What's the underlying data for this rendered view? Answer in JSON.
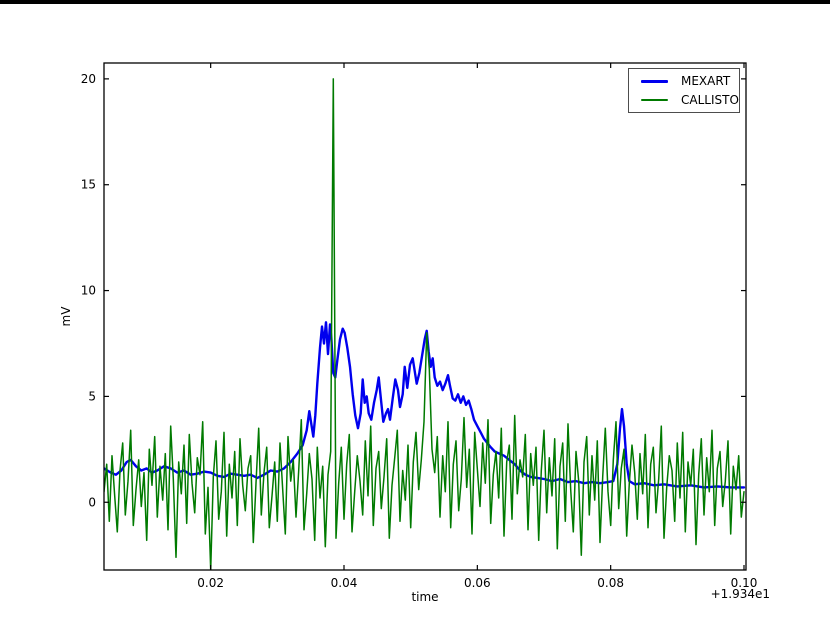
{
  "window": {
    "top_strip_color": "#000000",
    "background_color": "#ffffff"
  },
  "chart_data": {
    "type": "line",
    "title": "",
    "xlabel": "time",
    "ylabel": "mV",
    "x_offset_label": "+1.934e1",
    "grid": false,
    "axis_color": "#000000",
    "xlim": [
      0.004,
      0.1003
    ],
    "ylim": [
      -3.2,
      20.75
    ],
    "xticks": [
      {
        "v": 0.02,
        "label": "0.02"
      },
      {
        "v": 0.04,
        "label": "0.04"
      },
      {
        "v": 0.06,
        "label": "0.06"
      },
      {
        "v": 0.08,
        "label": "0.08"
      },
      {
        "v": 0.1,
        "label": "0.10"
      }
    ],
    "yticks": [
      {
        "v": 0,
        "label": "0"
      },
      {
        "v": 5,
        "label": "5"
      },
      {
        "v": 10,
        "label": "10"
      },
      {
        "v": 15,
        "label": "15"
      },
      {
        "v": 20,
        "label": "20"
      }
    ],
    "legend": {
      "position": "upper right",
      "entries": [
        {
          "name": "MEXART",
          "color": "#0000ee",
          "swatch_thickness": 3
        },
        {
          "name": "CALLISTO",
          "color": "#007a00",
          "swatch_thickness": 2
        }
      ]
    },
    "series": [
      {
        "name": "MEXART",
        "color": "#0000ee",
        "line_width": 2.4,
        "points": [
          [
            0.004,
            1.6
          ],
          [
            0.005,
            1.4
          ],
          [
            0.0058,
            1.3
          ],
          [
            0.0066,
            1.5
          ],
          [
            0.0074,
            1.9
          ],
          [
            0.008,
            2.0
          ],
          [
            0.0088,
            1.7
          ],
          [
            0.0096,
            1.5
          ],
          [
            0.0104,
            1.6
          ],
          [
            0.0112,
            1.4
          ],
          [
            0.012,
            1.5
          ],
          [
            0.013,
            1.7
          ],
          [
            0.014,
            1.6
          ],
          [
            0.015,
            1.4
          ],
          [
            0.016,
            1.5
          ],
          [
            0.017,
            1.3
          ],
          [
            0.018,
            1.35
          ],
          [
            0.019,
            1.45
          ],
          [
            0.02,
            1.4
          ],
          [
            0.021,
            1.25
          ],
          [
            0.022,
            1.2
          ],
          [
            0.023,
            1.35
          ],
          [
            0.024,
            1.3
          ],
          [
            0.025,
            1.25
          ],
          [
            0.026,
            1.3
          ],
          [
            0.027,
            1.15
          ],
          [
            0.028,
            1.3
          ],
          [
            0.029,
            1.5
          ],
          [
            0.03,
            1.45
          ],
          [
            0.031,
            1.6
          ],
          [
            0.032,
            1.9
          ],
          [
            0.033,
            2.3
          ],
          [
            0.0338,
            2.7
          ],
          [
            0.0344,
            3.4
          ],
          [
            0.0348,
            4.3
          ],
          [
            0.0351,
            3.7
          ],
          [
            0.0354,
            3.1
          ],
          [
            0.0357,
            4.1
          ],
          [
            0.036,
            5.6
          ],
          [
            0.0364,
            7.3
          ],
          [
            0.0367,
            8.3
          ],
          [
            0.037,
            7.5
          ],
          [
            0.0373,
            8.5
          ],
          [
            0.0376,
            7.0
          ],
          [
            0.0379,
            8.4
          ],
          [
            0.0381,
            7.8
          ],
          [
            0.0384,
            6.1
          ],
          [
            0.0387,
            5.9
          ],
          [
            0.039,
            6.7
          ],
          [
            0.0394,
            7.7
          ],
          [
            0.0398,
            8.2
          ],
          [
            0.0401,
            8.0
          ],
          [
            0.0405,
            7.3
          ],
          [
            0.0409,
            6.4
          ],
          [
            0.0413,
            5.1
          ],
          [
            0.0417,
            4.1
          ],
          [
            0.0421,
            3.5
          ],
          [
            0.0425,
            4.2
          ],
          [
            0.0428,
            5.8
          ],
          [
            0.0431,
            4.7
          ],
          [
            0.0434,
            5.0
          ],
          [
            0.0437,
            4.2
          ],
          [
            0.0441,
            3.9
          ],
          [
            0.0445,
            4.7
          ],
          [
            0.0449,
            5.3
          ],
          [
            0.0452,
            5.9
          ],
          [
            0.0456,
            4.7
          ],
          [
            0.0459,
            3.8
          ],
          [
            0.0463,
            4.2
          ],
          [
            0.0466,
            4.4
          ],
          [
            0.0469,
            3.9
          ],
          [
            0.0473,
            4.9
          ],
          [
            0.0477,
            5.8
          ],
          [
            0.0481,
            5.3
          ],
          [
            0.0484,
            4.5
          ],
          [
            0.0488,
            5.1
          ],
          [
            0.0491,
            6.4
          ],
          [
            0.0495,
            5.4
          ],
          [
            0.0499,
            6.5
          ],
          [
            0.0503,
            6.8
          ],
          [
            0.0506,
            6.2
          ],
          [
            0.0509,
            5.6
          ],
          [
            0.0513,
            6.1
          ],
          [
            0.0517,
            6.9
          ],
          [
            0.0521,
            7.7
          ],
          [
            0.0524,
            8.1
          ],
          [
            0.0527,
            7.1
          ],
          [
            0.053,
            6.4
          ],
          [
            0.0533,
            6.8
          ],
          [
            0.0536,
            5.9
          ],
          [
            0.054,
            5.5
          ],
          [
            0.0544,
            5.7
          ],
          [
            0.0548,
            5.3
          ],
          [
            0.0552,
            5.6
          ],
          [
            0.0556,
            6.0
          ],
          [
            0.0559,
            5.5
          ],
          [
            0.0563,
            4.9
          ],
          [
            0.0567,
            4.8
          ],
          [
            0.0571,
            5.1
          ],
          [
            0.0575,
            4.7
          ],
          [
            0.0579,
            5.0
          ],
          [
            0.0583,
            4.6
          ],
          [
            0.0587,
            4.8
          ],
          [
            0.0591,
            4.4
          ],
          [
            0.0595,
            3.9
          ],
          [
            0.06,
            3.6
          ],
          [
            0.0605,
            3.3
          ],
          [
            0.061,
            3.0
          ],
          [
            0.0615,
            2.8
          ],
          [
            0.062,
            2.6
          ],
          [
            0.0626,
            2.4
          ],
          [
            0.0633,
            2.3
          ],
          [
            0.064,
            2.2
          ],
          [
            0.0648,
            2.0
          ],
          [
            0.0656,
            1.8
          ],
          [
            0.0664,
            1.5
          ],
          [
            0.0672,
            1.3
          ],
          [
            0.068,
            1.2
          ],
          [
            0.069,
            1.15
          ],
          [
            0.07,
            1.1
          ],
          [
            0.0712,
            1.0
          ],
          [
            0.0724,
            1.1
          ],
          [
            0.0736,
            0.95
          ],
          [
            0.0748,
            1.0
          ],
          [
            0.076,
            0.9
          ],
          [
            0.0772,
            0.95
          ],
          [
            0.0784,
            0.9
          ],
          [
            0.0796,
            0.95
          ],
          [
            0.0804,
            1.0
          ],
          [
            0.081,
            1.8
          ],
          [
            0.0814,
            3.5
          ],
          [
            0.0817,
            4.4
          ],
          [
            0.082,
            3.6
          ],
          [
            0.0824,
            1.8
          ],
          [
            0.0828,
            1.0
          ],
          [
            0.0836,
            0.85
          ],
          [
            0.085,
            0.9
          ],
          [
            0.0865,
            0.8
          ],
          [
            0.088,
            0.85
          ],
          [
            0.09,
            0.75
          ],
          [
            0.092,
            0.8
          ],
          [
            0.094,
            0.7
          ],
          [
            0.096,
            0.75
          ],
          [
            0.098,
            0.7
          ],
          [
            0.1,
            0.7
          ]
        ]
      },
      {
        "name": "CALLISTO",
        "color": "#007a00",
        "line_width": 1.5,
        "t0": 0.004,
        "dt": 0.0004,
        "values": [
          0.5,
          1.8,
          -0.9,
          2.2,
          0.3,
          -1.4,
          1.5,
          2.8,
          -0.6,
          1.0,
          3.4,
          -1.1,
          0.6,
          2.0,
          -0.2,
          1.4,
          -1.8,
          2.5,
          0.8,
          3.1,
          -0.7,
          1.7,
          0.1,
          2.3,
          -1.3,
          3.6,
          1.1,
          -2.6,
          1.9,
          0.4,
          2.7,
          -1.0,
          3.2,
          0.9,
          -0.5,
          2.1,
          1.3,
          3.8,
          -1.5,
          0.7,
          -3.2,
          1.2,
          2.9,
          -0.8,
          0.5,
          3.3,
          -1.6,
          1.8,
          0.2,
          2.4,
          -1.1,
          3.0,
          0.8,
          -0.4,
          1.6,
          2.2,
          -1.9,
          0.9,
          3.5,
          -0.6,
          1.4,
          2.6,
          -1.2,
          0.3,
          1.9,
          -0.9,
          2.8,
          0.6,
          -1.5,
          3.1,
          1.0,
          2.0,
          -0.7,
          1.5,
          3.9,
          -1.3,
          0.4,
          2.3,
          1.1,
          -1.8,
          2.6,
          0.2,
          1.7,
          -2.1,
          1.3,
          2.4,
          20.0,
          -1.7,
          0.9,
          2.6,
          -0.8,
          1.8,
          3.2,
          -1.4,
          0.5,
          2.2,
          1.0,
          -0.6,
          2.9,
          0.3,
          3.6,
          -1.1,
          1.6,
          2.4,
          -0.3,
          1.2,
          3.0,
          -1.7,
          0.8,
          2.1,
          3.4,
          -0.9,
          1.5,
          0.1,
          2.7,
          -1.2,
          1.9,
          3.3,
          0.6,
          2.0,
          3.8,
          8.0,
          6.3,
          2.5,
          1.4,
          3.1,
          -0.7,
          2.2,
          0.5,
          3.8,
          -1.2,
          1.8,
          2.9,
          -0.4,
          1.1,
          4.0,
          0.7,
          2.5,
          -1.5,
          3.3,
          1.6,
          -0.2,
          2.8,
          0.9,
          3.9,
          -1.0,
          1.3,
          2.4,
          0.2,
          3.5,
          -1.6,
          1.9,
          2.7,
          -0.8,
          4.1,
          0.4,
          2.0,
          1.2,
          3.2,
          -1.3,
          2.3,
          0.8,
          2.6,
          -1.8,
          1.5,
          3.4,
          -0.5,
          2.1,
          0.3,
          3.0,
          -2.2,
          1.7,
          2.8,
          -0.9,
          3.7,
          0.6,
          -1.4,
          2.4,
          1.0,
          -2.5,
          1.9,
          3.1,
          -0.6,
          2.2,
          0.1,
          2.9,
          -1.9,
          1.2,
          3.5,
          0.5,
          -1.1,
          2.0,
          3.8,
          -0.3,
          1.6,
          2.5,
          -1.6,
          0.9,
          2.7,
          1.4,
          -0.8,
          2.3,
          0.4,
          3.2,
          -1.2,
          1.8,
          2.6,
          -0.5,
          1.1,
          3.6,
          -1.7,
          0.7,
          2.2,
          1.5,
          -0.9,
          2.8,
          0.2,
          3.3,
          -1.4,
          1.9,
          0.8,
          2.5,
          -2.0,
          1.3,
          3.0,
          -0.6,
          2.1,
          0.5,
          3.4,
          -1.1,
          1.6,
          2.4,
          -0.2,
          1.0,
          2.9,
          -1.5,
          1.7,
          0.6,
          2.2,
          -0.7,
          0.5
        ]
      }
    ]
  }
}
